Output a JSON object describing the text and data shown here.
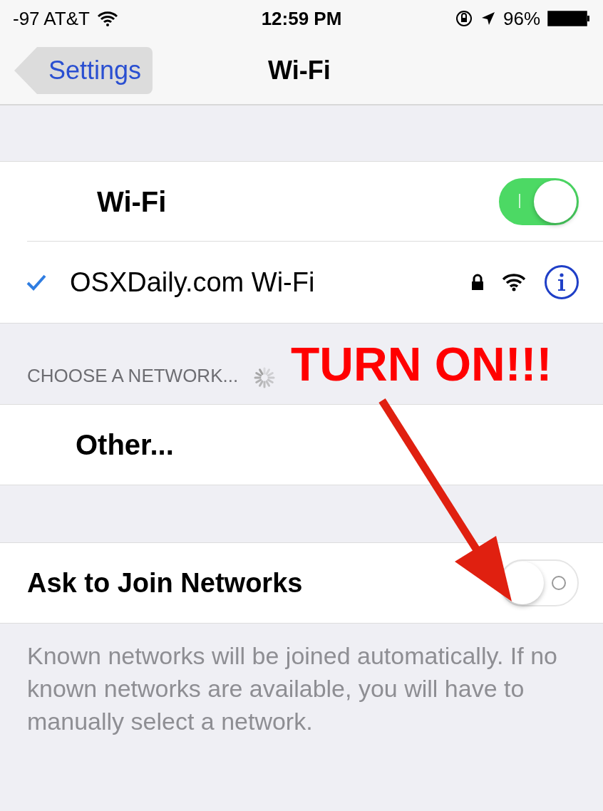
{
  "status_bar": {
    "carrier": "-97 AT&T",
    "time": "12:59 PM",
    "battery": "96%"
  },
  "nav": {
    "back": "Settings",
    "title": "Wi-Fi"
  },
  "wifi_toggle": {
    "label": "Wi-Fi",
    "on": true
  },
  "connected_network": {
    "name": "OSXDaily.com Wi-Fi",
    "selected": true,
    "secured": true
  },
  "network_header": "CHOOSE A NETWORK...",
  "other": "Other...",
  "ask_to_join": {
    "label": "Ask to Join Networks",
    "on": false
  },
  "footer": "Known networks will be joined automatically. If no known networks are available, you will have to manually select a network.",
  "annotation": {
    "text": "TURN ON!!!"
  }
}
